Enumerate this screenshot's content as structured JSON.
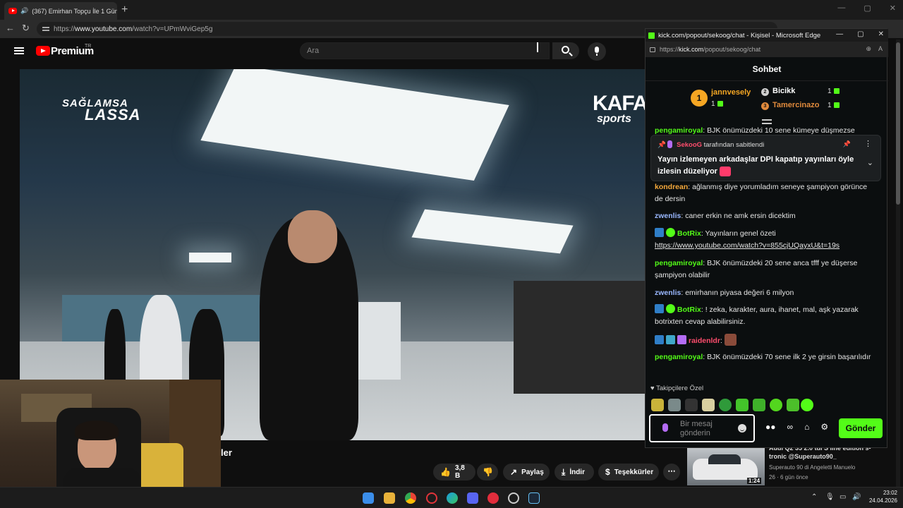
{
  "browser": {
    "tab_title": "(367) Emirhan Topçu İle 1 Gün",
    "url_prefix": "https://",
    "url_host": "www.youtube.com",
    "url_path": "/watch?v=UPmWviGep5g"
  },
  "youtube": {
    "brand": "Premium",
    "country": "TR",
    "search_placeholder": "Ara",
    "title_fragment": "ler",
    "actions": {
      "likes": "3,8 B",
      "share": "Paylaş",
      "download": "İndir",
      "thanks": "Teşekkürler"
    },
    "overlay": {
      "top_left_1": "SAĞLAMSA",
      "top_left_2": "LASSA",
      "top_right_1": "KAFA",
      "top_right_2": "sports"
    },
    "recommended": {
      "title": "Audi Q2 35 2.0 tdi S line edition s-tronic @Superauto90_",
      "channel": "Superauto 90 di Angeletti Manuelo",
      "meta": "26 · 6 gün önce",
      "duration": "1:24"
    }
  },
  "kick": {
    "window_title": "kick.com/popout/sekoog/chat - Kişisel - Microsoft Edge",
    "url_prefix": "https://",
    "url_host": "kick.com",
    "url_path": "/popout/sekoog/chat",
    "chat_title": "Sohbet",
    "leaderboard": [
      {
        "rank": "1",
        "name": "jannvesely",
        "count": "1",
        "color": "#f5a623"
      },
      {
        "rank": "2",
        "name": "Bicikk",
        "count": "1",
        "color": "#d0d0d0"
      },
      {
        "rank": "3",
        "name": "Tamercinazo",
        "count": "1",
        "color": "#e08a3c"
      }
    ],
    "pinned": {
      "by_user": "SekooG",
      "by_suffix": "tarafından sabitlendi",
      "text": "Yayın izlemeyen arkadaşlar DPI kapatıp yayınları öyle izlesin düzeliyor"
    },
    "cut_message": {
      "user": "pengamiroyal",
      "text": "BJK önümüzdeki 10 sene kümeye düşmezse"
    },
    "messages": [
      {
        "user": "kondrean",
        "user_color": "#f6a93b",
        "text": "ağlanmış diye yorumladım seneye şampiyon görünce de dersin"
      },
      {
        "user": "zwenlis",
        "user_color": "#9ab8ff",
        "text": "caner erkin ne amk ersin dicektim"
      },
      {
        "user": "BotRix",
        "user_color": "#53fc18",
        "text": "Yayınların genel özeti",
        "link": "https://www.youtube.com/watch?v=855cjUQayxU&t=19s"
      },
      {
        "user": "pengamiroyal",
        "user_color": "#53fc18",
        "text": "BJK önümüzdeki 20 sene anca tfff ye düşerse şampiyon olabilir"
      },
      {
        "user": "zwenlis",
        "user_color": "#9ab8ff",
        "text": "emirhanın piyasa değeri 6 milyon"
      },
      {
        "user": "BotRix",
        "user_color": "#53fc18",
        "text": "! zeka, karakter, aura, ihanet, mal, aşk yazarak botrixten cevap alabilirsiniz."
      },
      {
        "user": "raidenldr",
        "user_color": "#ff4d6d",
        "text": ""
      },
      {
        "user": "pengamiroyal",
        "user_color": "#53fc18",
        "text": "BJK önümüzdeki 70 sene ilk 2 ye girsin başarılıdır"
      }
    ],
    "followers_label": "Takipçilere Özel",
    "input_placeholder": "Bir mesaj gönderin",
    "send_label": "Gönder"
  },
  "taskbar": {
    "time": "23:02",
    "date": "24.04.2026"
  }
}
